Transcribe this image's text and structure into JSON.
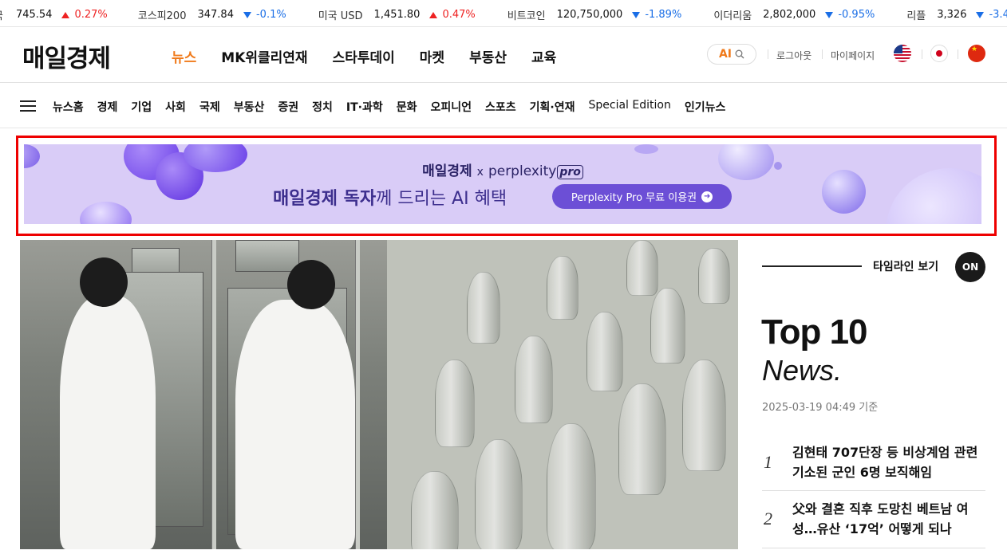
{
  "ticker": [
    {
      "name": "",
      "value": "745.54",
      "change": "0.27%",
      "dir": "up"
    },
    {
      "name": "코스피200",
      "value": "347.84",
      "change": "-0.1%",
      "dir": "down"
    },
    {
      "name": "미국 USD",
      "value": "1,451.80",
      "change": "0.47%",
      "dir": "up"
    },
    {
      "name": "비트코인",
      "value": "120,750,000",
      "change": "-1.89%",
      "dir": "down"
    },
    {
      "name": "이더리움",
      "value": "2,802,000",
      "change": "-0.95%",
      "dir": "down"
    },
    {
      "name": "리플",
      "value": "3,326",
      "change": "-3.4",
      "dir": "down"
    }
  ],
  "ticker_leading_fragment": "국",
  "header": {
    "logo": "매일경제",
    "nav": [
      "뉴스",
      "MK위클리연재",
      "스타투데이",
      "마켓",
      "부동산",
      "교육"
    ],
    "nav_active": "뉴스",
    "ai_label": "AI",
    "logout": "로그아웃",
    "mypage": "마이페이지"
  },
  "subnav": [
    "뉴스홈",
    "경제",
    "기업",
    "사회",
    "국제",
    "부동산",
    "증권",
    "정치",
    "IT·과학",
    "문화",
    "오피니언",
    "스포츠",
    "기획·연재",
    "Special Edition",
    "인기뉴스"
  ],
  "banner": {
    "brand_left": "매일경제",
    "brand_x": "x",
    "brand_right": "perplexity",
    "brand_pro": "pro",
    "headline_bold": "매일경제 독자",
    "headline_light": "께 드리는 AI 혜택",
    "cta": "Perplexity Pro 무료 이용권",
    "accent_color": "#6c4fd6"
  },
  "sidebar": {
    "timeline_label": "타임라인 보기",
    "toggle": "ON",
    "top10_title": "Top 10",
    "top10_sub": "News.",
    "timestamp": "2025-03-19 04:49 기준",
    "ranks": [
      {
        "num": "1",
        "title": "김현태 707단장 등 비상계엄 관련 기소된 군인 6명 보직해임"
      },
      {
        "num": "2",
        "title": "父와 결혼 직후 도망친 베트남 여성…유산 ‘17억’ 어떻게 되나"
      }
    ]
  }
}
